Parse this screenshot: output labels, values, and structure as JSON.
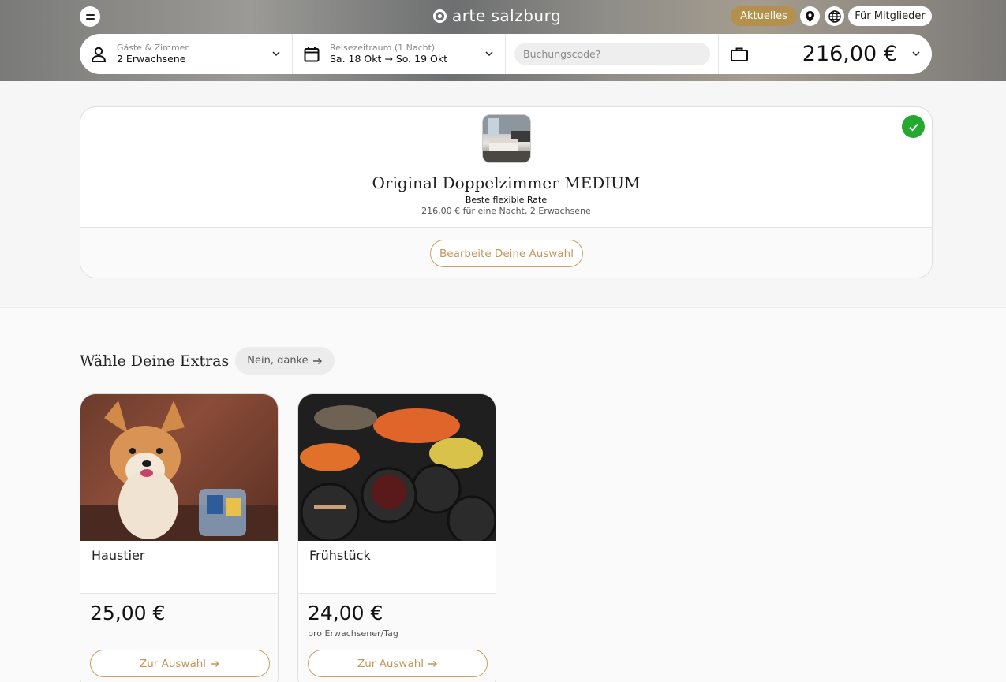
{
  "header": {
    "logo_text": "arte salzburg",
    "aktuelles_label": "Aktuelles",
    "members_label": "Für Mitglieder",
    "icons": [
      "menu-icon",
      "location-pin-icon",
      "globe-icon"
    ]
  },
  "booking": {
    "guests_label": "Gäste & Zimmer",
    "guests_value": "2 Erwachsene",
    "dates_label": "Reisezeitraum (1 Nacht)",
    "dates_value": "Sa. 18 Okt → So. 19 Okt",
    "code_placeholder": "Buchungscode?",
    "total": "216,00 €"
  },
  "selection": {
    "room_name": "Original Doppelzimmer MEDIUM",
    "rate": "Beste flexible Rate",
    "price_info": "216,00 € für eine Nacht, 2 Erwachsene",
    "edit_label": "Bearbeite Deine Auswahl"
  },
  "extras": {
    "title": "Wähle Deine Extras",
    "decline_label": "Nein, danke",
    "items": [
      {
        "title": "Haustier",
        "price": "25,00 €",
        "unit": "",
        "button": "Zur Auswahl"
      },
      {
        "title": "Frühstück",
        "price": "24,00 €",
        "unit": "pro Erwachsener/Tag",
        "button": "Zur Auswahl"
      }
    ]
  },
  "colors": {
    "accent_gold": "#b3904e",
    "button_border": "#c9a062",
    "success_green": "#25a830"
  }
}
